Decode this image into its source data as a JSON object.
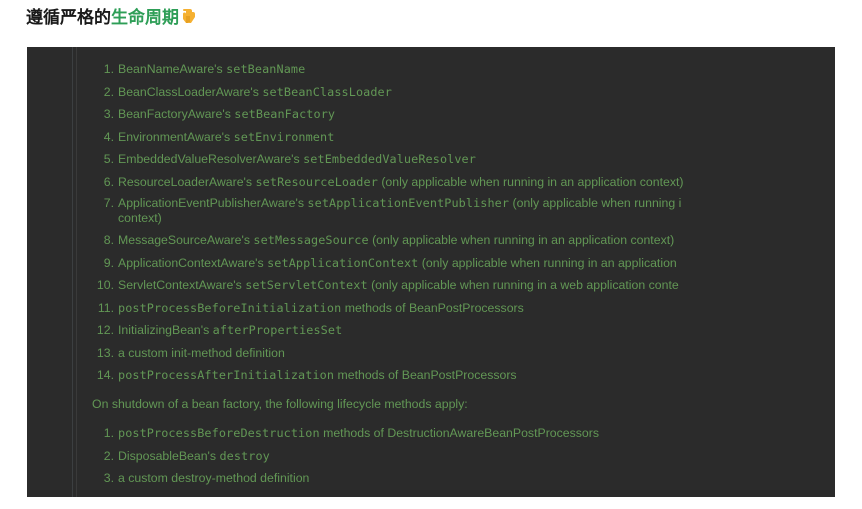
{
  "heading": {
    "text_before": "遵循严格的",
    "highlight": "生命周期",
    "icon": "pointing-hand-emoji-icon"
  },
  "colors": {
    "panel_bg": "#2b2b2b",
    "doc_text": "#629755",
    "highlight": "#2e9e57"
  },
  "startup_list": [
    {
      "num": "1.",
      "pre": "BeanNameAware's ",
      "code": "setBeanName",
      "post": ""
    },
    {
      "num": "2.",
      "pre": "BeanClassLoaderAware's ",
      "code": "setBeanClassLoader",
      "post": ""
    },
    {
      "num": "3.",
      "pre": "BeanFactoryAware's ",
      "code": "setBeanFactory",
      "post": ""
    },
    {
      "num": "4.",
      "pre": "EnvironmentAware's ",
      "code": "setEnvironment",
      "post": ""
    },
    {
      "num": "5.",
      "pre": "EmbeddedValueResolverAware's ",
      "code": "setEmbeddedValueResolver",
      "post": ""
    },
    {
      "num": "6.",
      "pre": "ResourceLoaderAware's ",
      "code": "setResourceLoader",
      "post": " (only applicable when running in an application context)"
    },
    {
      "num": "7.",
      "pre": "ApplicationEventPublisherAware's ",
      "code": "setApplicationEventPublisher",
      "post": " (only applicable when running i",
      "post2": "context)"
    },
    {
      "num": "8.",
      "pre": "MessageSourceAware's ",
      "code": "setMessageSource",
      "post": " (only applicable when running in an application context)"
    },
    {
      "num": "9.",
      "pre": "ApplicationContextAware's ",
      "code": "setApplicationContext",
      "post": " (only applicable when running in an application"
    },
    {
      "num": "10.",
      "pre": "ServletContextAware's ",
      "code": "setServletContext",
      "post": " (only applicable when running in a web application conte"
    },
    {
      "num": "11.",
      "pre": "",
      "code": "postProcessBeforeInitialization",
      "post": " methods of BeanPostProcessors"
    },
    {
      "num": "12.",
      "pre": "InitializingBean's ",
      "code": "afterPropertiesSet",
      "post": ""
    },
    {
      "num": "13.",
      "pre": "a custom init-method definition",
      "code": "",
      "post": ""
    },
    {
      "num": "14.",
      "pre": "",
      "code": "postProcessAfterInitialization",
      "post": " methods of BeanPostProcessors"
    }
  ],
  "shutdown_intro": "On shutdown of a bean factory, the following lifecycle methods apply:",
  "shutdown_list": [
    {
      "num": "1.",
      "pre": "",
      "code": "postProcessBeforeDestruction",
      "post": " methods of DestructionAwareBeanPostProcessors"
    },
    {
      "num": "2.",
      "pre": "DisposableBean's ",
      "code": "destroy",
      "post": ""
    },
    {
      "num": "3.",
      "pre": "a custom destroy-method definition",
      "code": "",
      "post": ""
    }
  ]
}
